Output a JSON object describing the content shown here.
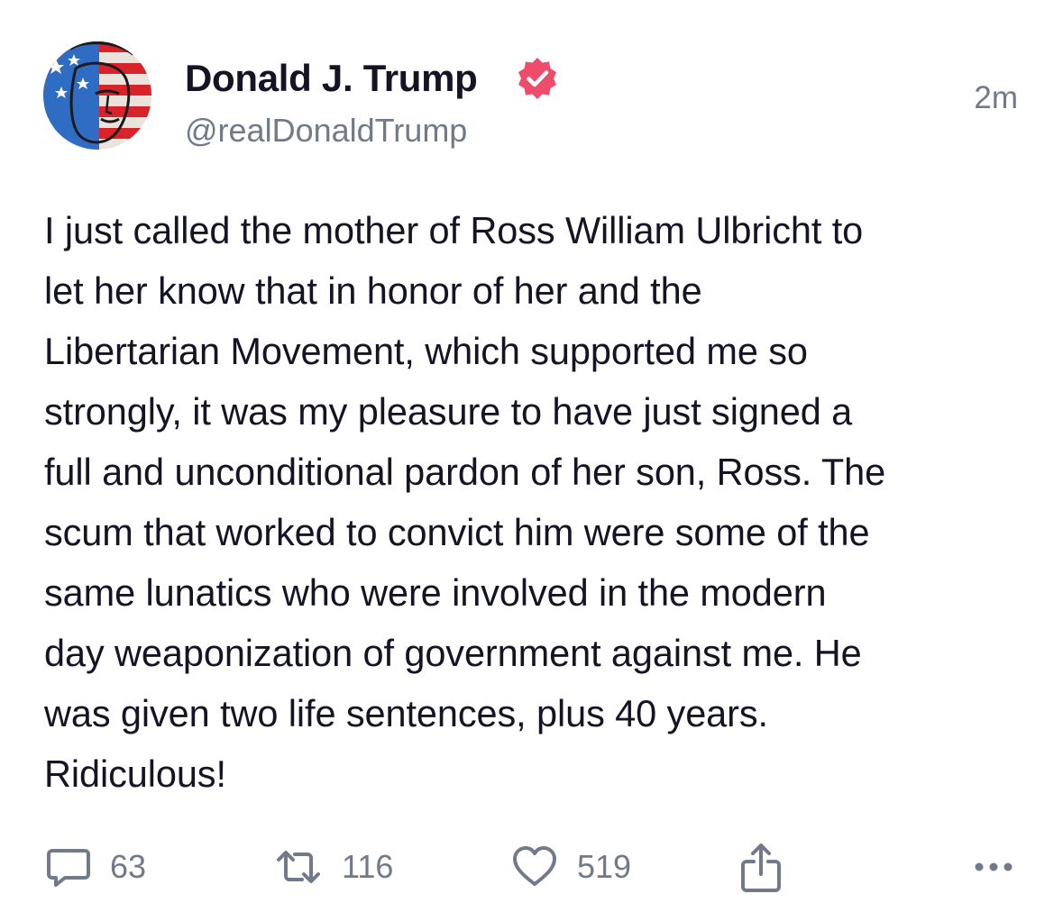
{
  "post": {
    "author": {
      "display_name": "Donald J. Trump",
      "handle": "@realDonaldTrump",
      "verified": true,
      "avatar": "avatar-image"
    },
    "timestamp": "2m",
    "body": "I just called the mother of Ross William Ulbricht to\nlet her know that in honor of her and the\nLibertarian Movement, which supported me so\nstrongly, it was my pleasure to have just signed a\nfull and unconditional pardon of her son, Ross. The\nscum that worked to convict him were some of the\nsame lunatics who were involved in the modern\nday weaponization of government against me. He\nwas given two life sentences, plus 40 years.\nRidiculous!"
  },
  "actions": {
    "replies": {
      "icon": "comment-icon",
      "count": "63"
    },
    "retruths": {
      "icon": "retruth-icon",
      "count": "116"
    },
    "likes": {
      "icon": "heart-icon",
      "count": "519"
    },
    "share": {
      "icon": "share-icon"
    },
    "more": {
      "icon": "more-icon"
    }
  },
  "colors": {
    "text": "#141425",
    "muted": "#727a89",
    "verified_badge": "#ee4c6b"
  }
}
